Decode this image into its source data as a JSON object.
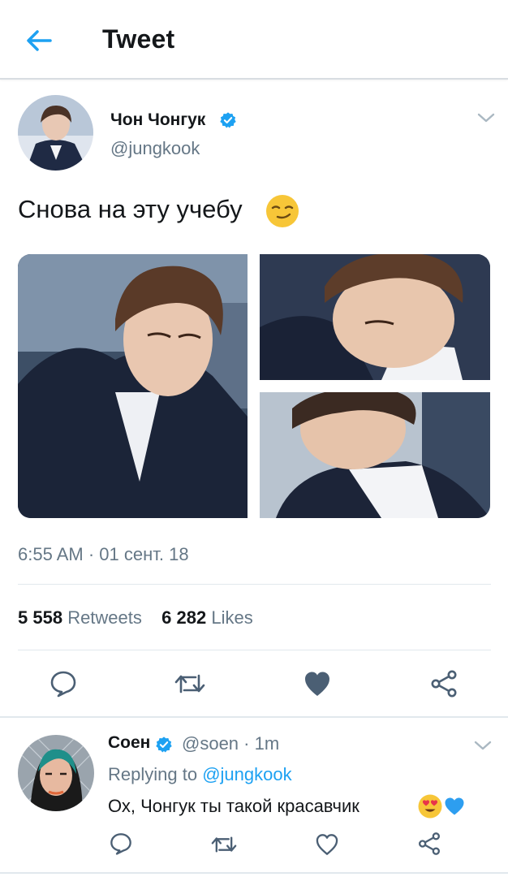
{
  "header": {
    "title": "Tweet"
  },
  "tweet": {
    "author_name": "Чон Чонгук",
    "author_handle": "@jungkook",
    "text": "Снова на эту учебу",
    "text_emoji": "smirking-face-emoji",
    "timestamp": "6:55 AM · 01 сент. 18",
    "stats": {
      "retweets_count": "5 558",
      "retweets_label": "Retweets",
      "likes_count": "6 282",
      "likes_label": "Likes"
    },
    "liked": true
  },
  "reply": {
    "author_name": "Соен",
    "author_handle": "@soen · 1m",
    "replying_prefix": "Replying to",
    "replying_to": "@jungkook",
    "text": "Ох, Чонгук ты такой красавчик",
    "emojis": [
      "smiling-face-with-heart-eyes-emoji",
      "blue-heart-emoji"
    ]
  },
  "colors": {
    "accent": "#1da1f2",
    "text_primary": "#14171a",
    "text_secondary": "#657786",
    "liked_heart": "#4b5f74",
    "divider": "#e1e8ed"
  }
}
